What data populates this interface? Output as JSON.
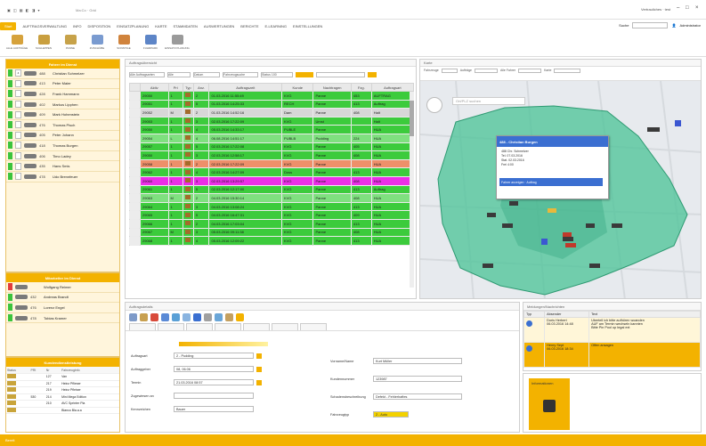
{
  "titlebar": {
    "qa": "▣ ◫ ▦ ◧ ◨ ▾",
    "title": "Ma:Co  ·  Grid",
    "user": "Vertrauliches  ·  test",
    "min": "–",
    "max": "□",
    "close": "×"
  },
  "menu": {
    "items": [
      "Start",
      "AUFTRAGSVERWALTUNG",
      "INFO",
      "DISPOSITION",
      "EINSATZPLANUNG",
      "KARTE",
      "STAMMDATEN",
      "AUSWERTUNGEN",
      "BERICHTE",
      "E-LEARNING",
      "EINSTELLUNGEN"
    ],
    "active_index": 0,
    "search_label": "Suche",
    "right_label": "Administrator"
  },
  "ribbon": {
    "buttons": [
      {
        "label": "ALLE AUFTRÄGE",
        "color": "#d6a23c"
      },
      {
        "label": "SCHLEPPEN",
        "color": "#c99f3f"
      },
      {
        "label": "PANNE",
        "color": "#c7a249"
      },
      {
        "label": "ZUSCHÜBE",
        "color": "#7a9bd0"
      },
      {
        "label": "SONSTIGE",
        "color": "#d0833c"
      },
      {
        "label": "FUHRPARK",
        "color": "#5d85c7"
      },
      {
        "label": "EINSATZ PLANUNG",
        "color": "#9a9a9a"
      }
    ]
  },
  "vehicles": {
    "title": "Fahrer im Dienst",
    "rows": [
      {
        "status": "#3cc43c",
        "num": "4",
        "code": "488",
        "name": "Christian Schmelzer"
      },
      {
        "status": "#3cc43c",
        "num": "",
        "code": "413",
        "name": "Peter Maier"
      },
      {
        "status": "#3cc43c",
        "num": "",
        "code": "428",
        "name": "Frank Hammann"
      },
      {
        "status": "#3cc43c",
        "num": "",
        "code": "402",
        "name": "Markus Lipphen"
      },
      {
        "status": "#3cc43c",
        "num": "",
        "code": "409",
        "name": "Mark Hohenstein"
      },
      {
        "status": "#3cc43c",
        "num": "",
        "code": "476",
        "name": "Thomas Pisch"
      },
      {
        "status": "#3cc43c",
        "num": "",
        "code": "405",
        "name": "Peter Johann"
      },
      {
        "status": "#3cc43c",
        "num": "",
        "code": "418",
        "name": "Thomas Burgen"
      },
      {
        "status": "#3cc43c",
        "num": "",
        "code": "406",
        "name": "Timo Ladey"
      },
      {
        "status": "#3cc43c",
        "num": "",
        "code": "435",
        "name": "Hans Smis"
      },
      {
        "status": "#3cc43c",
        "num": "",
        "code": "478",
        "name": "Udo Brennfeuer"
      }
    ]
  },
  "staff": {
    "title": "Mitarbeiter im Dienst",
    "rows": [
      {
        "status": "#e23b3b",
        "code": "",
        "name": "Wolfgang Reimer"
      },
      {
        "status": "#3cc43c",
        "code": "432",
        "name": "Andreas Brandt"
      },
      {
        "status": "#3cc43c",
        "code": "476",
        "name": "Lorenz Engel"
      },
      {
        "status": "#3cc43c",
        "code": "478",
        "name": "Tobias Kramer"
      }
    ]
  },
  "tbl2": {
    "title": "Kundendienstleistung",
    "headers": [
      "Status",
      "PRI",
      "Nr",
      "Fahrzeuginfo"
    ],
    "rows": [
      [
        "",
        "",
        "127",
        "Van"
      ],
      [
        "",
        "",
        "217",
        "Heinz Pflieser"
      ],
      [
        "",
        "",
        "219",
        "Heinz Pfleiser"
      ],
      [
        "",
        "530",
        "214",
        "Mini Mega Edition"
      ],
      [
        "",
        "",
        "210",
        "AVC Sprinter Pla"
      ],
      [
        "",
        "",
        "",
        "Blanco Bla.a.a"
      ]
    ]
  },
  "orders": {
    "title": "Auftragsübersicht",
    "filter1": "Alle Auftragsarten",
    "filter2": "Alle",
    "filter3": "Datum",
    "filter4": "Fahrzeugsuche",
    "filter5": "Status 100",
    "headers": [
      "",
      "Aktiv",
      "Pri",
      "Typ",
      "Anz.",
      "Auftragszeit",
      "Kunde",
      "Nachtragen",
      "Fzg.",
      "Auftragsart"
    ],
    "rows": [
      {
        "color": "#3ccb3c",
        "nr": "29050",
        "pri": "1",
        "anz": "2",
        "time": "01.03.2016 11:55:49",
        "kunde": "KVG",
        "name": "Panne",
        "fzg": "453",
        "art": "AUFTRAG"
      },
      {
        "color": "#3ccb3c",
        "nr": "29051",
        "pri": "1",
        "anz": "5",
        "time": "01.03.2016 14:25:33",
        "kunde": "RECH",
        "name": "Panne",
        "fzg": "413",
        "art": "Auftrag"
      },
      {
        "color": "#d7d7d7",
        "nr": "29052",
        "pri": "M",
        "anz": "2",
        "time": "01.03.2016 14:52:16",
        "kunde": "Dam",
        "name": "Panne",
        "fzg": "408",
        "art": "Halt"
      },
      {
        "color": "#3ccb3c",
        "nr": "29053",
        "pri": "1",
        "anz": "3",
        "time": "02.03.2016 17:22:09",
        "kunde": "KVG",
        "name": "Umst",
        "fzg": "",
        "art": "Halt"
      },
      {
        "color": "#3ccb3c",
        "nr": "29050",
        "pri": "1",
        "anz": "4",
        "time": "05.03.2016 14:33:17",
        "kunde": "PUBLE",
        "name": "Panne",
        "fzg": "",
        "art": "HUA"
      },
      {
        "color": "#7fe07f",
        "nr": "29054",
        "pri": "L",
        "anz": "4",
        "time": "06.08.2016 14:51:17",
        "kunde": "PUBLB",
        "name": "Pudding",
        "fzg": "224",
        "art": "HUA"
      },
      {
        "color": "#3ccb3c",
        "nr": "29057",
        "pri": "1",
        "anz": "5",
        "time": "02.03.2016 17:22:08",
        "kunde": "KVG",
        "name": "Panne",
        "fzg": "405",
        "art": "HUA"
      },
      {
        "color": "#3ccb3c",
        "nr": "29050",
        "pri": "1",
        "anz": "3",
        "time": "02.03.2016 12:58:17",
        "kunde": "KVG",
        "name": "Panne",
        "fzg": "408",
        "art": "HUA"
      },
      {
        "color": "#ee8f6a",
        "nr": "29058",
        "pri": "1",
        "anz": "2",
        "time": "02.03.2016 17:22:09",
        "kunde": "KVG",
        "name": "Panne",
        "fzg": "",
        "art": "HUA"
      },
      {
        "color": "#3ccb3c",
        "nr": "29062",
        "pri": "1",
        "anz": "4",
        "time": "02.03.2016 14:27:09",
        "kunde": "Doss",
        "name": "Panne",
        "fzg": "413",
        "art": "HUA"
      },
      {
        "color": "#ea2ee6",
        "nr": "29060",
        "pri": "1",
        "anz": "3",
        "time": "02.03.2016 13:29:57",
        "kunde": "KVG",
        "name": "Panne",
        "fzg": "408",
        "art": "HUA"
      },
      {
        "color": "#3ccb3c",
        "nr": "29061",
        "pri": "1",
        "anz": "5",
        "time": "02.03.2016 12:17:00",
        "kunde": "KVG",
        "name": "Panne",
        "fzg": "413",
        "art": "Auftrag"
      },
      {
        "color": "#7fe07f",
        "nr": "29063",
        "pri": "M",
        "anz": "2",
        "time": "04.03.2016 15:30:14",
        "kunde": "KVG",
        "name": "Panne",
        "fzg": "408",
        "art": "HUA"
      },
      {
        "color": "#3ccb3c",
        "nr": "29064",
        "pri": "1",
        "anz": "3",
        "time": "04.03.2016 13:08:24",
        "kunde": "KVG",
        "name": "Panne",
        "fzg": "413",
        "art": "HUA"
      },
      {
        "color": "#3ccb3c",
        "nr": "29065",
        "pri": "1",
        "anz": "5",
        "time": "04.03.2016 16:47:31",
        "kunde": "KVG",
        "name": "Panne",
        "fzg": "409",
        "art": "HUA"
      },
      {
        "color": "#3ccb3c",
        "nr": "29066",
        "pri": "1",
        "anz": "2",
        "time": "04.03.2016 17:03:04",
        "kunde": "KVG",
        "name": "Panne",
        "fzg": "413",
        "art": "HUA"
      },
      {
        "color": "#3ccb3c",
        "nr": "29067",
        "pri": "M",
        "anz": "3",
        "time": "05.03.2016 09:11:38",
        "kunde": "KVG",
        "name": "Panne",
        "fzg": "408",
        "art": "HUA"
      },
      {
        "color": "#3ccb3c",
        "nr": "29068",
        "pri": "1",
        "anz": "4",
        "time": "05.03.2016 12:09:22",
        "kunde": "KVG",
        "name": "Panne",
        "fzg": "413",
        "art": "HUA"
      }
    ]
  },
  "map": {
    "title": "Karte",
    "search_placeholder": "Ort/PLZ suchen",
    "tool1": "Fahrzeuge",
    "tool2": "Aufträge",
    "tool3": "Alle Fahrer",
    "tool4": "Karte",
    "popup": {
      "title": "488 - Christian Burgen",
      "lines": [
        "488 Chr. Schmelzer",
        "Tel.      07.03.2016",
        "Stat.    02.03.2016",
        "Frei      4:00"
      ],
      "footer": "Fahrer anzeigen  ·  Auftrag"
    },
    "zone_color": "#4fc49a"
  },
  "detail": {
    "title": "Auftragsdetails",
    "fields_left": [
      {
        "label": "Auftragsart",
        "value": "2 - Pudding"
      },
      {
        "label": "Auftraggeber",
        "value": "08, 06.06"
      },
      {
        "label": "Termin",
        "value": "21.03.2016    08:57"
      },
      {
        "label": "Zugewiesen an",
        "value": ""
      },
      {
        "label": "Kennzeichen",
        "value": "Bauer"
      }
    ],
    "fields_right": [
      {
        "label": "Vorname/Name",
        "value": "Kurt Müller"
      },
      {
        "label": "Kundennummer",
        "value": "123987"
      },
      {
        "label": "Schadensbeschreibung",
        "value": "Defekt - Fehlerhaftes"
      },
      {
        "label": "Fahrzeugtyp",
        "value": "2 - Auto"
      }
    ]
  },
  "messages": {
    "title": "Meldungen/Nachrichten",
    "headers": [
      "Typ",
      "Absender",
      "Text"
    ],
    "rows": [
      {
        "sender": "Doris Herbert\n06.03.2016      14:48",
        "text": "Ubertell ich bitte aufhören woanden\nAUF am Termin wechseln kannten\nBitte Pin Pool up legal ext",
        "hl": false
      },
      {
        "sender": "Henry Sept\n06.03.2016      18:34",
        "text": "Offen ansagen",
        "hl": true
      }
    ]
  },
  "info": {
    "title": "Informationen",
    "tile_label": ""
  },
  "statusbar": {
    "text": "Bereit"
  }
}
